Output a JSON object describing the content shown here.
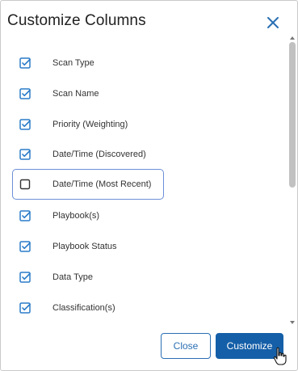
{
  "dialog": {
    "title": "Customize Columns",
    "close_icon": "close-x-icon"
  },
  "colors": {
    "accent": "#2a6fb3",
    "primary_button": "#155fa8",
    "checkbox_checked": "#2a7bc8",
    "focus_border": "#6b8fd6"
  },
  "columns": [
    {
      "label": "Scan Type",
      "checked": true
    },
    {
      "label": "Scan Name",
      "checked": true
    },
    {
      "label": "Priority (Weighting)",
      "checked": true
    },
    {
      "label": "Date/Time (Discovered)",
      "checked": true
    },
    {
      "label": "Date/Time (Most Recent)",
      "checked": false
    },
    {
      "label": "Playbook(s)",
      "checked": true
    },
    {
      "label": "Playbook Status",
      "checked": true
    },
    {
      "label": "Data Type",
      "checked": true
    },
    {
      "label": "Classification(s)",
      "checked": true
    }
  ],
  "footer": {
    "close_label": "Close",
    "customize_label": "Customize"
  }
}
